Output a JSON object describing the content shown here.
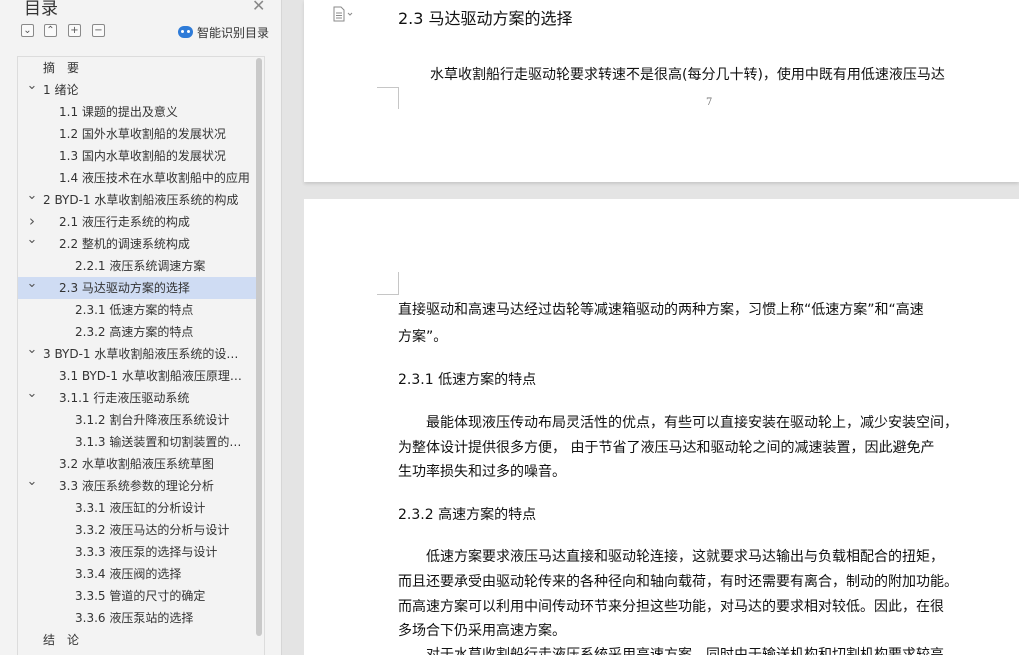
{
  "toc_panel": {
    "title": "目录",
    "close_glyph": "✕",
    "toolbar": [
      "⌄",
      "⌃",
      "+",
      "−"
    ],
    "smart_toc_label": "智能识别目录",
    "items": [
      {
        "label": "摘　要",
        "expandable": false
      },
      {
        "label": "1  绪论",
        "expandable": true,
        "expanded": true
      },
      {
        "label": "1.1 课题的提出及意义",
        "expandable": false
      },
      {
        "label": "1.2 国外水草收割船的发展状况",
        "expandable": false
      },
      {
        "label": "1.3 国内水草收割船的发展状况",
        "expandable": false
      },
      {
        "label": "1.4 液压技术在水草收割船中的应用",
        "expandable": false
      },
      {
        "label": "2 BYD-1 水草收割船液压系统的构成",
        "expandable": true,
        "expanded": true
      },
      {
        "label": "2.1  液压行走系统的构成",
        "expandable": true,
        "expanded": false
      },
      {
        "label": "2.2 整机的调速系统构成",
        "expandable": true,
        "expanded": true
      },
      {
        "label": "2.2.1 液压系统调速方案",
        "expandable": false
      },
      {
        "label": "2.3 马达驱动方案的选择",
        "expandable": true,
        "expanded": true,
        "active": true
      },
      {
        "label": "2.3.1 低速方案的特点",
        "expandable": false
      },
      {
        "label": "2.3.2 高速方案的特点",
        "expandable": false
      },
      {
        "label": "3 BYD-1 水草收割船液压系统的设计计算",
        "expandable": true,
        "expanded": true
      },
      {
        "label": "3.1 BYD-1 水草收割船液压原理图的拟定",
        "expandable": false
      },
      {
        "label": "3.1.1 行走液压驱动系统",
        "expandable": true,
        "expanded": true
      },
      {
        "label": "3.1.2  割台升降液压系统设计",
        "expandable": false
      },
      {
        "label": "3.1.3 输送装置和切割装置的液压系统设计",
        "expandable": false
      },
      {
        "label": "3.2 水草收割船液压系统草图",
        "expandable": false
      },
      {
        "label": "3.3  液压系统参数的理论分析",
        "expandable": true,
        "expanded": true
      },
      {
        "label": "3.3.1  液压缸的分析设计",
        "expandable": false
      },
      {
        "label": "3.3.2 液压马达的分析与设计",
        "expandable": false
      },
      {
        "label": "3.3.3 液压泵的选择与设计",
        "expandable": false
      },
      {
        "label": "3.3.4  液压阀的选择",
        "expandable": false
      },
      {
        "label": "3.3.5 管道的尺寸的确定",
        "expandable": false
      },
      {
        "label": "3.3.6 液压泵站的选择",
        "expandable": false
      },
      {
        "label": "结　论",
        "expandable": false
      }
    ]
  },
  "document": {
    "page_top": {
      "heading": "2.3 马达驱动方案的选择",
      "paragraph": "水草收割船行走驱动轮要求转速不是很高(每分几十转)，使用中既有用低速液压马达",
      "page_number": "7"
    },
    "page_bottom": {
      "lines": [
        {
          "kind": "para",
          "text": "直接驱动和高速马达经过齿轮等减速箱驱动的两种方案，习惯上称“低速方案”和“高速"
        },
        {
          "kind": "para",
          "text": "方案”。"
        },
        {
          "kind": "subhead",
          "text": "2.3.1 低速方案的特点"
        },
        {
          "kind": "para",
          "text": "　　最能体现液压传动布局灵活性的优点，有些可以直接安装在驱动轮上，减少安装空间，"
        },
        {
          "kind": "para",
          "text": "为整体设计提供很多方便，  由于节省了液压马达和驱动轮之间的减速装置，因此避免产"
        },
        {
          "kind": "para",
          "text": "生功率损失和过多的噪音。"
        },
        {
          "kind": "subhead",
          "text": "2.3.2 高速方案的特点"
        },
        {
          "kind": "para",
          "text": "　　低速方案要求液压马达直接和驱动轮连接，这就要求马达输出与负载相配合的扭矩，"
        },
        {
          "kind": "para",
          "text": "而且还要承受由驱动轮传来的各种径向和轴向载荷，有时还需要有离合，制动的附加功能。"
        },
        {
          "kind": "para",
          "text": "而高速方案可以利用中间传动环节来分担这些功能，对马达的要求相对较低。因此，在很"
        },
        {
          "kind": "para",
          "text": "多场合下仍采用高速方案。"
        },
        {
          "kind": "para",
          "text": "　　对于水草收割船行走液压系统采用高速方案，同时由于输送机构和切割机构要求较高"
        }
      ]
    }
  }
}
